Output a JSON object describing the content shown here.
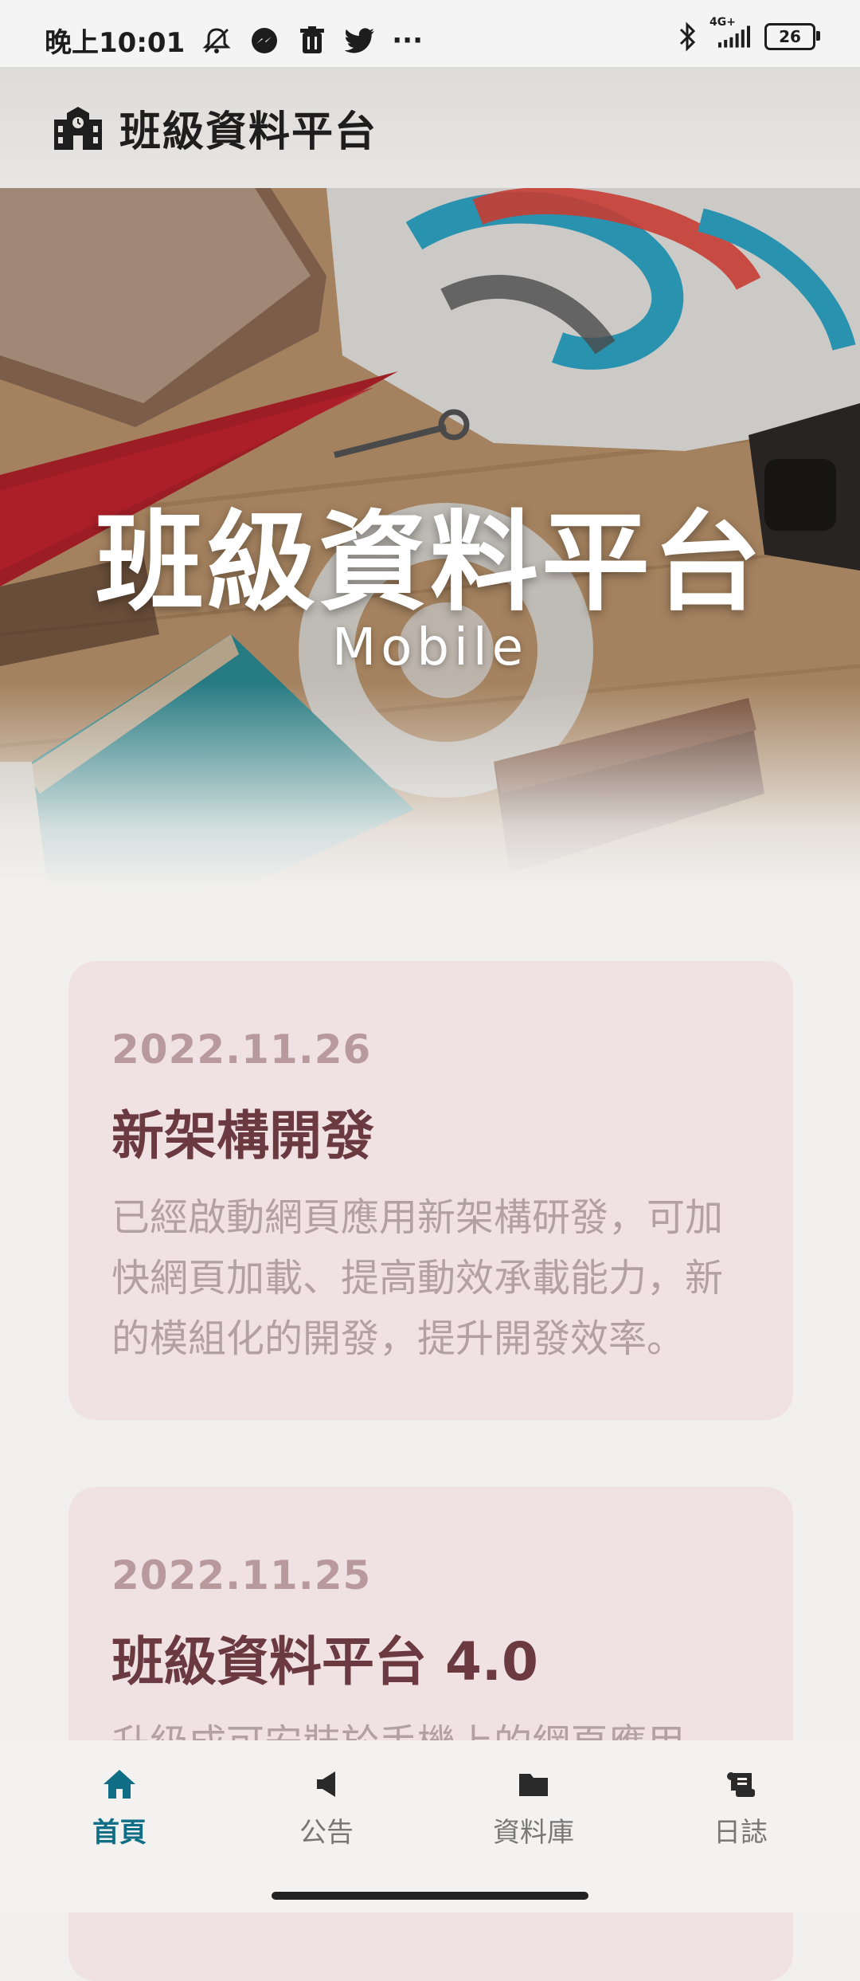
{
  "status_bar": {
    "time": "晚上10:01",
    "network": "4G+",
    "battery": "26",
    "more": "···"
  },
  "header": {
    "title": "班級資料平台"
  },
  "hero": {
    "title": "班級資料平台",
    "subtitle": "Mobile"
  },
  "posts": [
    {
      "date": "2022.11.26",
      "title": "新架構開發",
      "body": "已經啟動網頁應用新架構研發，可加快網頁加載、提高動效承載能力，新的模組化的開發，提升開發效率。"
    },
    {
      "date": "2022.11.25",
      "title": "班級資料平台 4.0",
      "body": "升級成可安裝於手機上的網頁應用。"
    }
  ],
  "nav": {
    "items": [
      {
        "label": "首頁",
        "icon": "home-icon",
        "active": true
      },
      {
        "label": "公告",
        "icon": "megaphone-icon",
        "active": false
      },
      {
        "label": "資料庫",
        "icon": "folder-icon",
        "active": false
      },
      {
        "label": "日誌",
        "icon": "scroll-icon",
        "active": false
      }
    ],
    "active_color": "#0f6d86"
  }
}
